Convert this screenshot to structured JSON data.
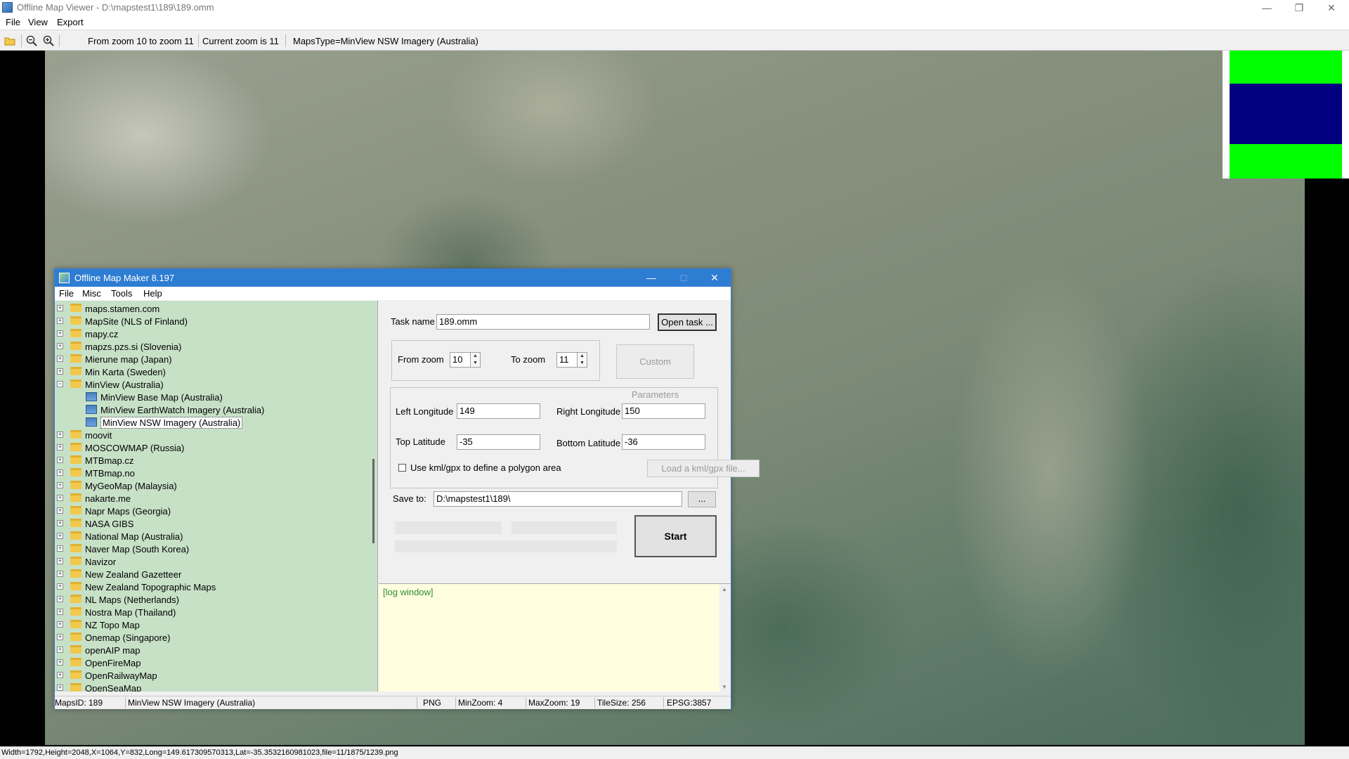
{
  "main_window": {
    "title": "Offline Map Viewer - D:\\mapstest1\\189\\189.omm",
    "menu": [
      "File",
      "View",
      "Export"
    ],
    "toolbar": {
      "zoom_range": "From zoom 10 to zoom 11",
      "current_zoom": "Current zoom is 11",
      "maps_type": "MapsType=MinView NSW Imagery (Australia)"
    },
    "status": "Width=1792,Height=2048,X=1064,Y=832,Long=149.617309570313,Lat=-35.3532160981023,file=11/1875/1239.png",
    "icons": [
      "open-folder-icon",
      "zoom-out-icon",
      "zoom-in-icon"
    ]
  },
  "dialog": {
    "title": "Offline Map Maker 8.197",
    "menu": [
      "File",
      "Misc",
      "Tools",
      "Help"
    ],
    "tree": [
      {
        "label": "maps.stamen.com",
        "level": 0,
        "expanded": false
      },
      {
        "label": "MapSite (NLS of Finland)",
        "level": 0,
        "expanded": false
      },
      {
        "label": "mapy.cz",
        "level": 0,
        "expanded": false
      },
      {
        "label": "mapzs.pzs.si (Slovenia)",
        "level": 0,
        "expanded": false
      },
      {
        "label": "Mierune map (Japan)",
        "level": 0,
        "expanded": false
      },
      {
        "label": "Min Karta (Sweden)",
        "level": 0,
        "expanded": false
      },
      {
        "label": "MinView (Australia)",
        "level": 0,
        "expanded": true
      },
      {
        "label": "MinView Base Map (Australia)",
        "level": 1
      },
      {
        "label": "MinView EarthWatch Imagery (Australia)",
        "level": 1
      },
      {
        "label": "MinView NSW Imagery (Australia)",
        "level": 1,
        "selected": true
      },
      {
        "label": "moovit",
        "level": 0,
        "expanded": false
      },
      {
        "label": "MOSCOWMAP (Russia)",
        "level": 0,
        "expanded": false
      },
      {
        "label": "MTBmap.cz",
        "level": 0,
        "expanded": false
      },
      {
        "label": "MTBmap.no",
        "level": 0,
        "expanded": false
      },
      {
        "label": "MyGeoMap (Malaysia)",
        "level": 0,
        "expanded": false
      },
      {
        "label": "nakarte.me",
        "level": 0,
        "expanded": false
      },
      {
        "label": "Napr Maps (Georgia)",
        "level": 0,
        "expanded": false
      },
      {
        "label": "NASA GIBS",
        "level": 0,
        "expanded": false
      },
      {
        "label": "National Map (Australia)",
        "level": 0,
        "expanded": false
      },
      {
        "label": "Naver Map (South Korea)",
        "level": 0,
        "expanded": false
      },
      {
        "label": "Navizor",
        "level": 0,
        "expanded": false
      },
      {
        "label": "New Zealand Gazetteer",
        "level": 0,
        "expanded": false
      },
      {
        "label": "New Zealand Topographic Maps",
        "level": 0,
        "expanded": false
      },
      {
        "label": "NL Maps (Netherlands)",
        "level": 0,
        "expanded": false
      },
      {
        "label": "Nostra Map (Thailand)",
        "level": 0,
        "expanded": false
      },
      {
        "label": "NZ Topo Map",
        "level": 0,
        "expanded": false
      },
      {
        "label": "Onemap (Singapore)",
        "level": 0,
        "expanded": false
      },
      {
        "label": "openAIP map",
        "level": 0,
        "expanded": false
      },
      {
        "label": "OpenFireMap",
        "level": 0,
        "expanded": false
      },
      {
        "label": "OpenRailwayMap",
        "level": 0,
        "expanded": false
      },
      {
        "label": "OpenSeaMap",
        "level": 0,
        "expanded": false
      }
    ],
    "task": {
      "label": "Task name",
      "value": "189.omm",
      "open_button": "Open task ..."
    },
    "zoom": {
      "from_label": "From zoom",
      "from_value": "10",
      "to_label": "To zoom",
      "to_value": "11",
      "custom_button": "Custom Parameters"
    },
    "bounds": {
      "left_lon_label": "Left Longitude",
      "left_lon": "149",
      "right_lon_label": "Right Longitude",
      "right_lon": "150",
      "top_lat_label": "Top Latitude",
      "top_lat": "-35",
      "bottom_lat_label": "Bottom Latitude",
      "bottom_lat": "-36",
      "kml_checkbox": "Use kml/gpx to define a polygon area",
      "kml_checked": false,
      "kml_button": "Load a kml/gpx file..."
    },
    "save": {
      "label": "Save to:",
      "value": "D:\\mapstest1\\189\\",
      "browse_button": "...",
      "start_button": "Start"
    },
    "log": "[log window]",
    "status": {
      "maps_id": "MapsID: 189",
      "maps_name": "MinView NSW Imagery (Australia)",
      "format": "PNG",
      "min_zoom": "MinZoom: 4",
      "max_zoom": "MaxZoom: 19",
      "tile_size": "TileSize: 256",
      "epsg": "EPSG:3857"
    }
  },
  "colors": {
    "dialog_title_bg": "#2d7dd2",
    "tree_bg": "#c7e1c7",
    "log_bg": "#ffffe0",
    "minimap_green": "#00ff00",
    "minimap_blue": "#000080"
  }
}
